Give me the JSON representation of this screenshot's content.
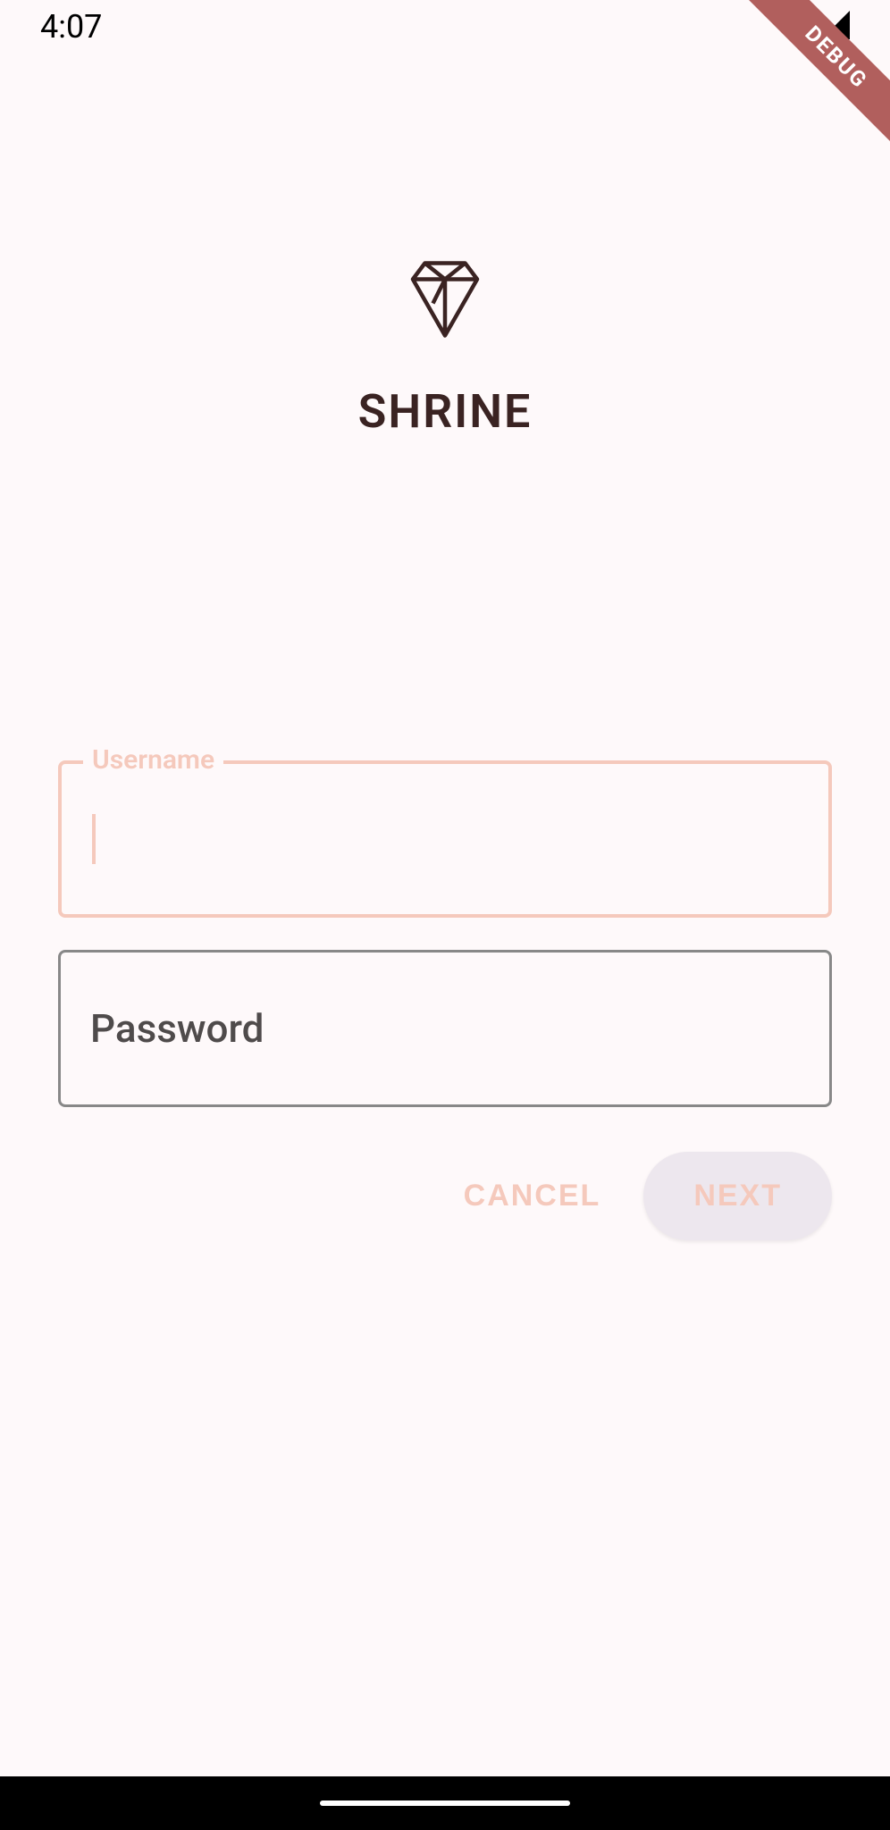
{
  "status_bar": {
    "time": "4:07"
  },
  "debug_banner": "DEBUG",
  "app": {
    "title": "SHRINE"
  },
  "form": {
    "username": {
      "label": "Username",
      "value": ""
    },
    "password": {
      "placeholder": "Password",
      "value": ""
    },
    "buttons": {
      "cancel": "CANCEL",
      "next": "NEXT"
    }
  }
}
